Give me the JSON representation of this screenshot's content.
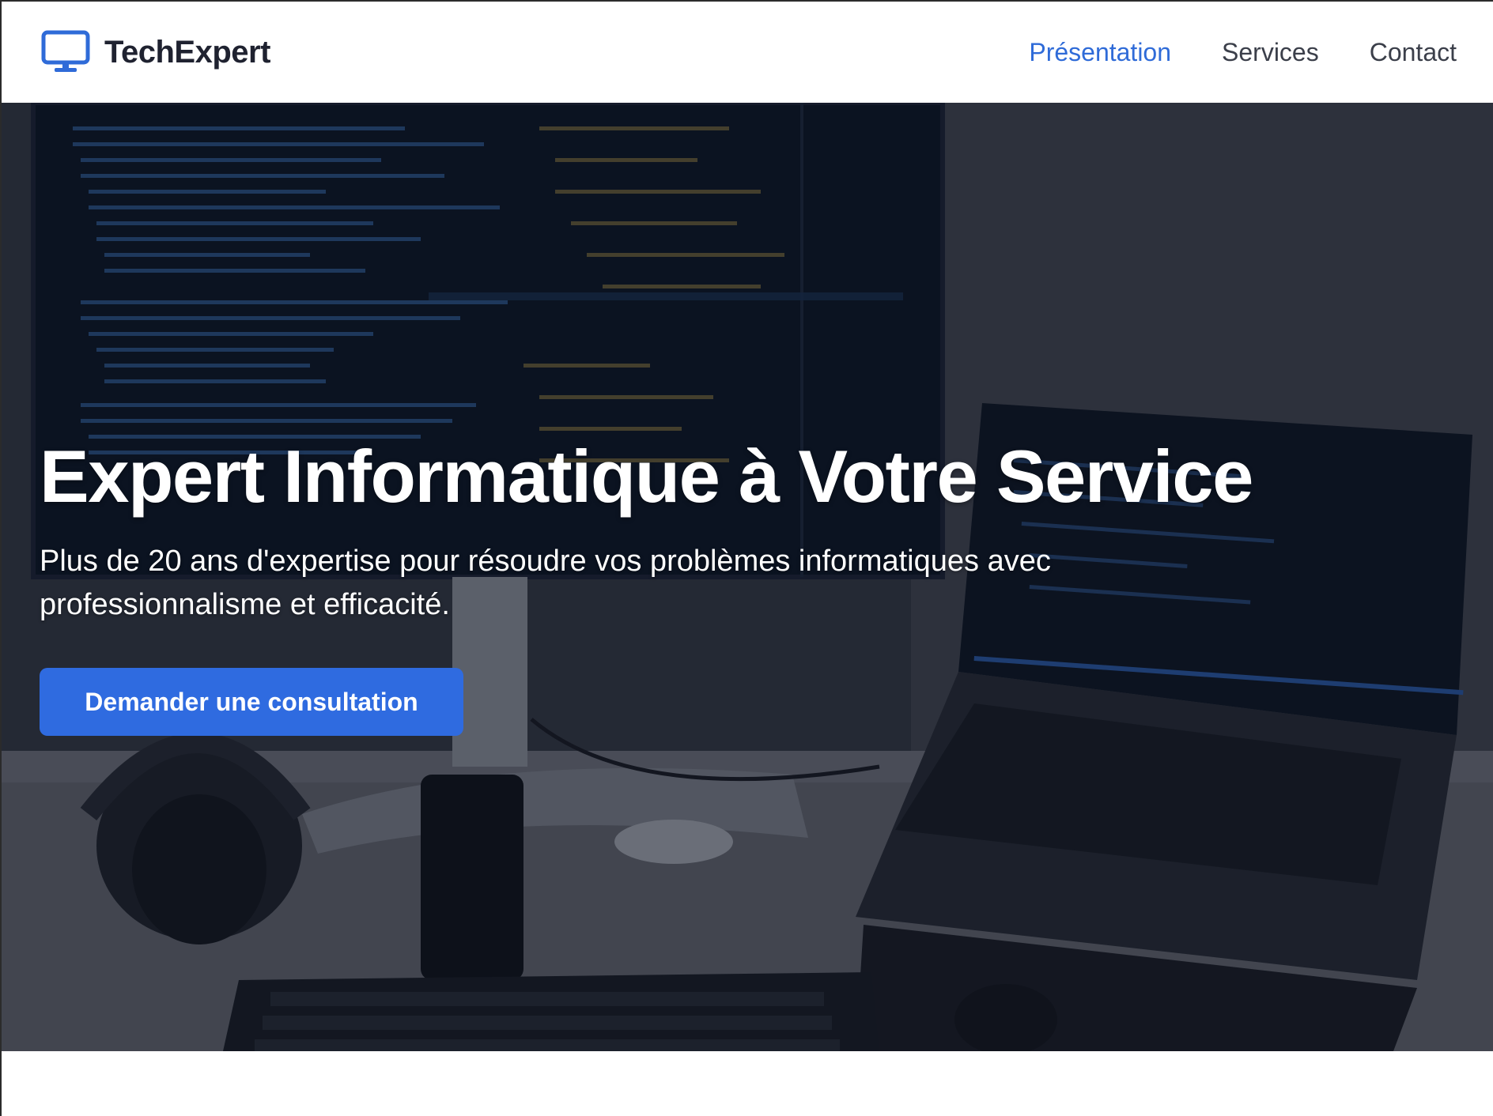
{
  "brand": {
    "name": "TechExpert",
    "icon": "monitor-icon"
  },
  "nav": {
    "items": [
      {
        "label": "Présentation",
        "active": true
      },
      {
        "label": "Services",
        "active": false
      },
      {
        "label": "Contact",
        "active": false
      }
    ]
  },
  "hero": {
    "title": "Expert Informatique à Votre Service",
    "subtitle": "Plus de 20 ans d'expertise pour résoudre vos problèmes informatiques avec professionnalisme et efficacité.",
    "cta_label": "Demander une consultation"
  },
  "colors": {
    "accent": "#2f6be0",
    "nav_active": "#2f6bd8",
    "nav_text": "#3b3f4a",
    "brand_text": "#1f2230"
  }
}
